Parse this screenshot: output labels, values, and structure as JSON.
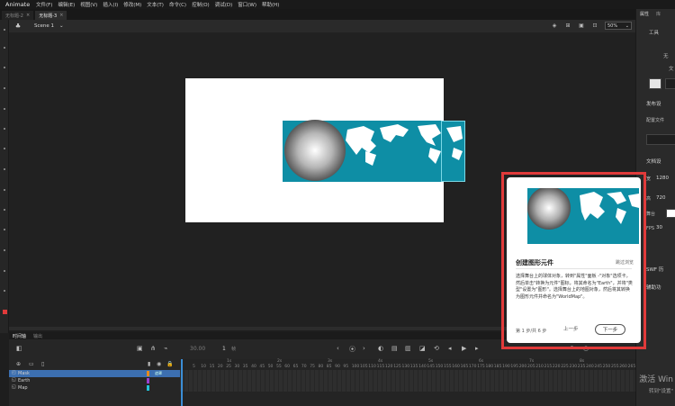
{
  "app": {
    "name": "Animate",
    "workspace": "基本功能"
  },
  "menu": [
    "文件(F)",
    "编辑(E)",
    "视图(V)",
    "插入(I)",
    "修改(M)",
    "文本(T)",
    "命令(C)",
    "控制(O)",
    "调试(D)",
    "窗口(W)",
    "帮助(H)"
  ],
  "doc_tabs": [
    {
      "label": "无标题-2",
      "active": false
    },
    {
      "label": "无标题-3",
      "active": true
    }
  ],
  "edit_bar": {
    "scene": "Scene 1",
    "zoom": "50%"
  },
  "timeline": {
    "tabs": [
      "时间轴",
      "输出"
    ],
    "fps": "30.00",
    "fps_unit": "fps",
    "frame": "1",
    "frame_unit": "帧",
    "ruler": [
      "1s",
      "2s",
      "3s",
      "4s",
      "5s",
      "6s",
      "7s",
      "8s",
      "9s"
    ],
    "frame_numbers": [
      "5",
      "10",
      "15",
      "20",
      "25",
      "30",
      "35",
      "40",
      "45",
      "50",
      "55",
      "60",
      "65",
      "70",
      "75",
      "80",
      "85",
      "90",
      "95",
      "100",
      "105",
      "110",
      "115",
      "120",
      "125",
      "130",
      "135",
      "140",
      "145",
      "150",
      "155",
      "160",
      "165",
      "170",
      "175",
      "180",
      "185",
      "190",
      "195",
      "200",
      "205",
      "210",
      "215",
      "220",
      "225",
      "230",
      "235",
      "240",
      "245",
      "250",
      "255",
      "260",
      "265",
      "270"
    ],
    "layers": [
      {
        "name": "Mask",
        "color": "#e68a1c",
        "selected": true,
        "tag": "遮罩"
      },
      {
        "name": "Earth",
        "color": "#9a3fd0",
        "selected": false,
        "tag": ""
      },
      {
        "name": "Map",
        "color": "#22c3d8",
        "selected": false,
        "tag": ""
      }
    ]
  },
  "right_panel": {
    "tabs": [
      "属性",
      "库"
    ],
    "tools_label": "工具",
    "none_label": "无",
    "doc_label": "文",
    "publish_section": "发布设",
    "profile_label": "配置文件",
    "doc_settings_section": "文档设",
    "width_label": "宽",
    "width": "1280",
    "height_label": "高",
    "height": "720",
    "stage_label": "舞台",
    "fps_label": "FPS",
    "fps": "30",
    "swf_section": "SWF 历",
    "a11y_section": "辅助功"
  },
  "watermark": {
    "line1": "激活 Win",
    "line2": "转到\"设置\""
  },
  "tutorial": {
    "title": "创建图形元件",
    "skip": "跳过浏览",
    "body": "选择舞台上的球体对象，转到\"属性\"面板 -\"对象\"选项卡，然后单击\"转换为元件\"图标，将其命名为\"Earth\"，并将\"类型\"设置为\"图形\"。选择舞台上的地图对象，然后将其转换为图形元件并命名为\"WorldMap\"。",
    "step": "第 1 步/共 6 步",
    "prev": "上一步",
    "next": "下一步"
  },
  "colors": {
    "accent_red": "#e03a3a",
    "band_teal": "#0e8ea5",
    "selected_layer": "#3c6fb0",
    "playhead": "#3b8ed6"
  }
}
